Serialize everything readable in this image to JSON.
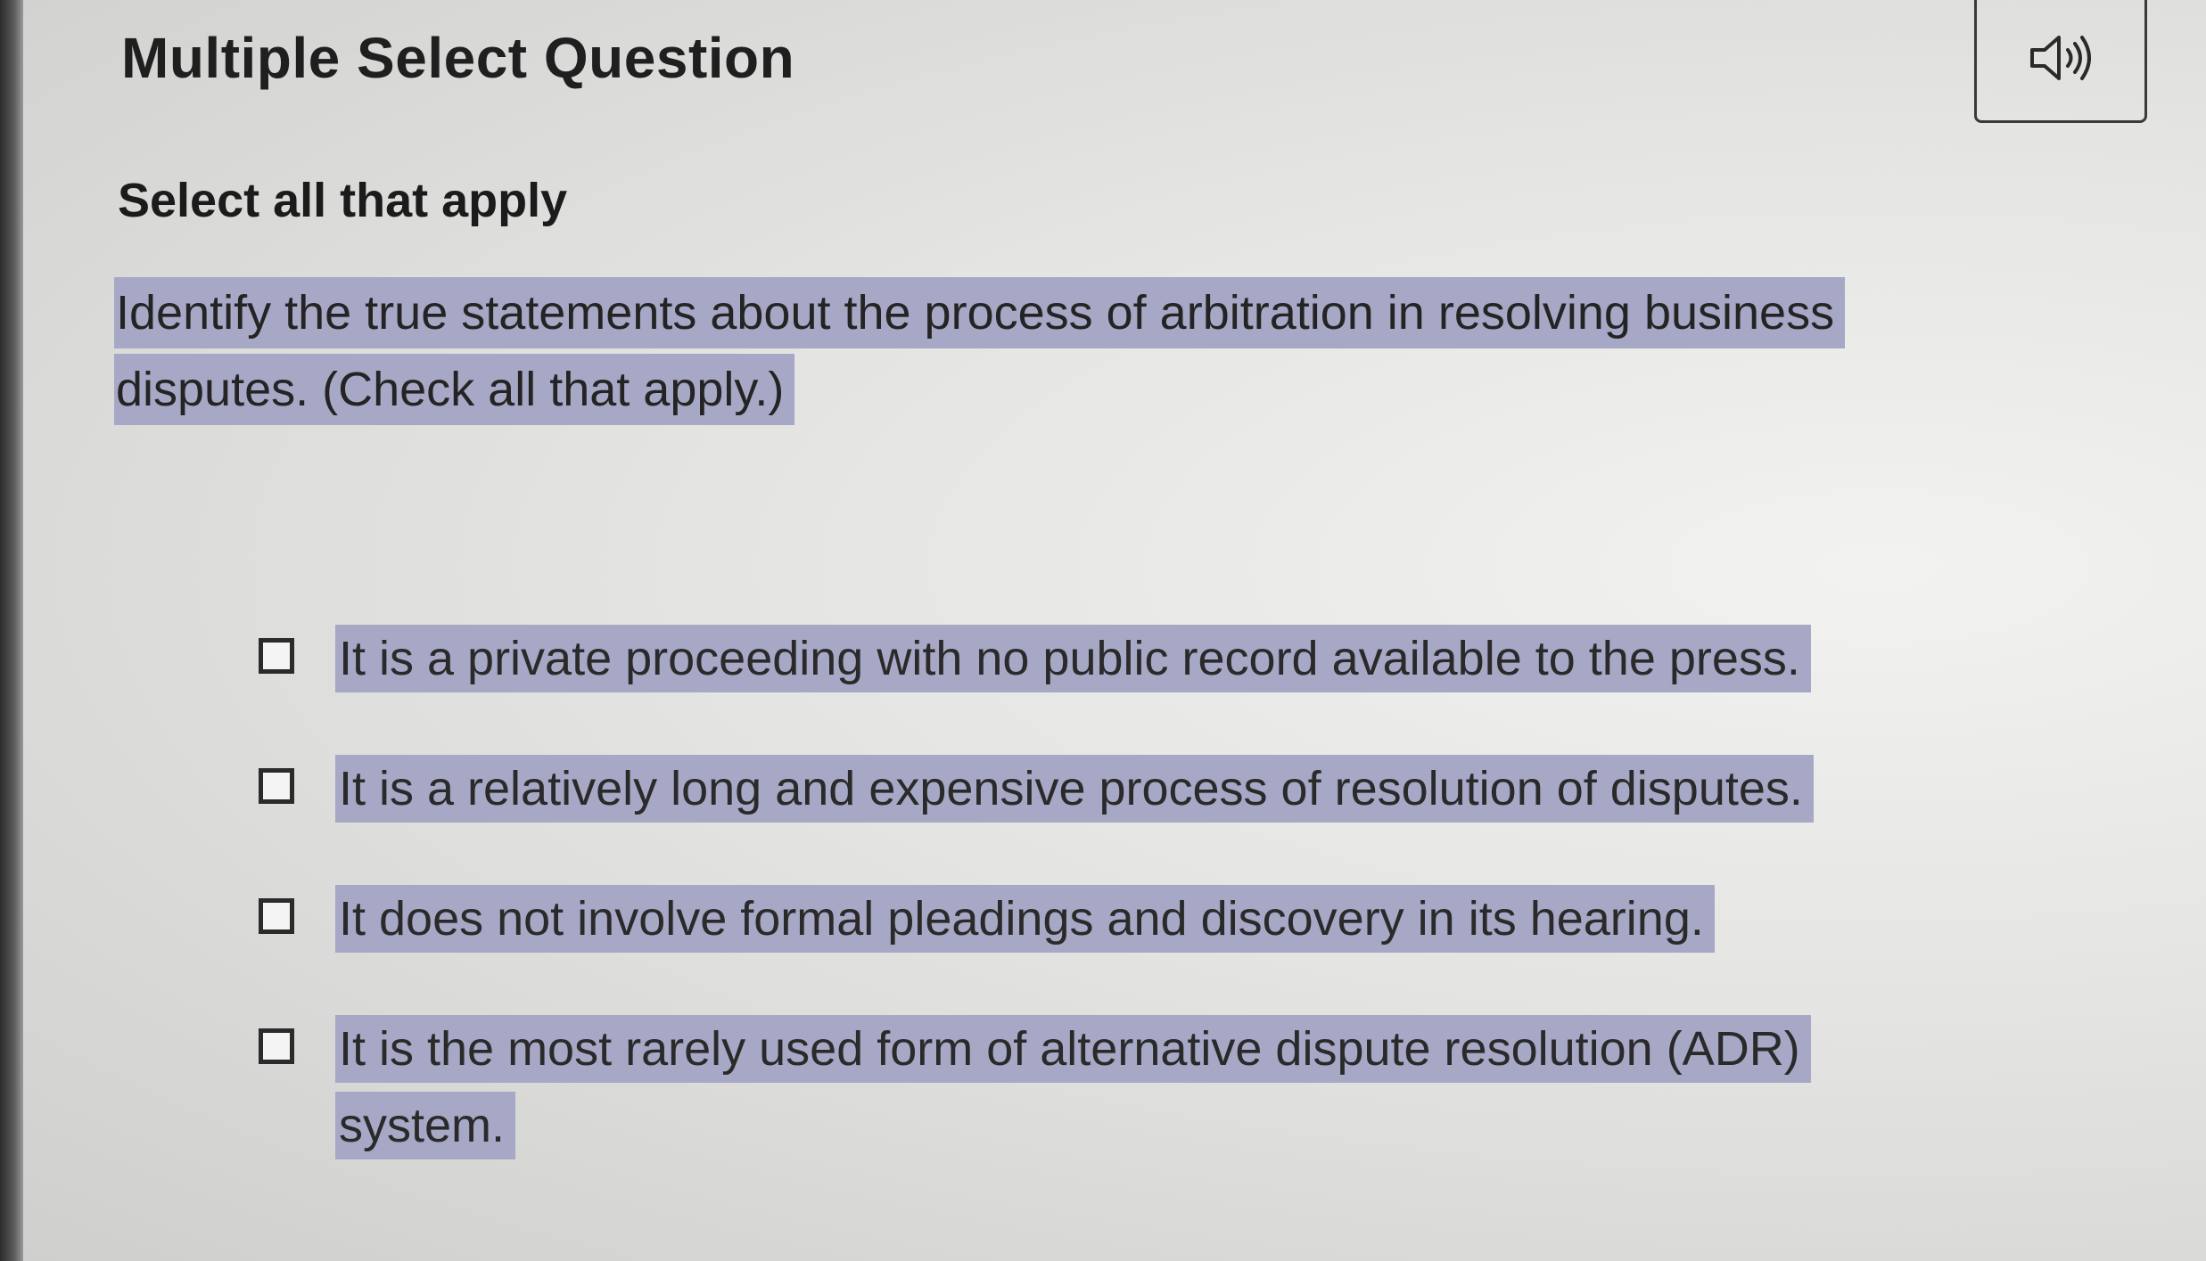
{
  "header": {
    "title": "Multiple Select Question",
    "audio_icon": "speaker-icon"
  },
  "instruction": "Select all that apply",
  "question": {
    "text": "Identify the true statements about the process of arbitration in resolving business disputes. (Check all that apply.)"
  },
  "options": [
    {
      "label": "It is a private proceeding with no public record available to the press.",
      "checked": false
    },
    {
      "label": "It is a relatively long and expensive process of resolution of disputes.",
      "checked": false
    },
    {
      "label": "It does not involve formal pleadings and discovery in its hearing.",
      "checked": false
    },
    {
      "label": "It is the most rarely used form of alternative dispute resolution (ADR) system.",
      "checked": false
    }
  ],
  "colors": {
    "highlight": "#a6a8c6",
    "text": "#242424"
  }
}
